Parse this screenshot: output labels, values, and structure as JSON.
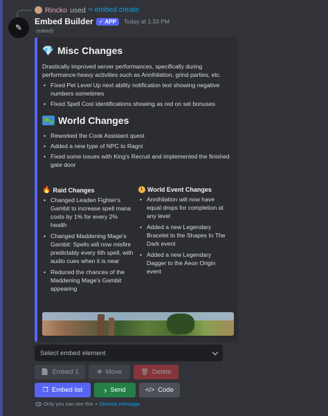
{
  "reply": {
    "username": "Rincko",
    "verb": "used",
    "command": "embed create",
    "command_icon": "slash-command-icon"
  },
  "message": {
    "author": "Embed Builder",
    "badge": "APP",
    "badge_icon": "check-icon",
    "timestamp": "Today at 1:33 PM",
    "edited": "(edited)"
  },
  "embed": {
    "color": "#5865f2",
    "sections": {
      "misc": {
        "emoji": "💎",
        "title": "Misc Changes",
        "intro": "Drastically improved server performances, specifically during performance-heavy activities such as Annihilation, grind parties, etc.",
        "items": [
          "Fixed Pet Level Up next ability notification text showing negative numbers sometimes",
          "Fixed Spell Cost identifications showing as red on set bonuses"
        ]
      },
      "world": {
        "emoji": "map-icon",
        "title": "World Changes",
        "items": [
          "Reworked the Cook Assistant quest",
          "Added a new type of NPC to Ragni",
          "Fixed some issues with King's Recruit and implemented the finished gate door"
        ]
      },
      "raid": {
        "emoji": "🔥",
        "title": "Raid Changes",
        "items": [
          "Changed Leaden Fighter's Gambit to increase spell mana costs by 1% for every 2% health",
          "Changed Maddening Mage's Gambit: Spells will now misfire predictably every 6th spell, with audio cues when it is near",
          "Reduced the chances of the Maddening Mage's Gambit appearing"
        ]
      },
      "world_event": {
        "emoji": "clock-icon",
        "title": "World Event Changes",
        "items": [
          "Annihilation will now have equal drops for completion at any level",
          "Added a new Legendary Bracelet to the Shapes In The Dark event",
          "Added a new Legendary Dagger to the Aeon Origin event"
        ]
      }
    }
  },
  "controls": {
    "select_placeholder": "Select embed element",
    "buttons": {
      "embed1": {
        "label": "Embed 1",
        "icon": "📄"
      },
      "move": {
        "label": "Move",
        "icon": "✥"
      },
      "delete": {
        "label": "Delete",
        "icon": "🗑"
      },
      "embed_list": {
        "label": "Embed list",
        "icon": "❐"
      },
      "send": {
        "label": "Send",
        "icon": "›"
      },
      "code": {
        "label": "Code",
        "icon": "</>"
      }
    }
  },
  "footer": {
    "notice": "Only you can see this",
    "separator": "•",
    "dismiss": "Dismiss message"
  }
}
